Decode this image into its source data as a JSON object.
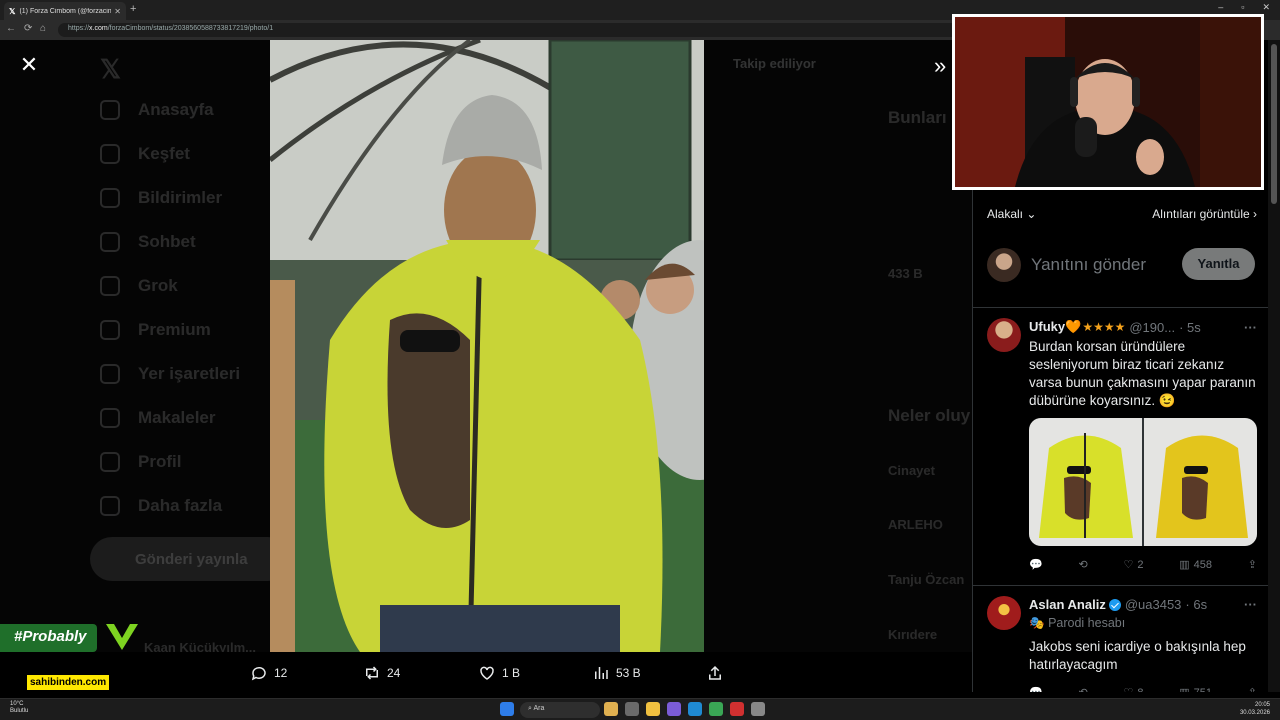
{
  "browser": {
    "tab_title": "(1) Forza Cimbom (@forzacimbom",
    "url_prefix": "https://",
    "url_domain": "x.com",
    "url_path": "/forzaCimbom/status/2038560588733817219/photo/1"
  },
  "background": {
    "nav_items": [
      "Anasayfa",
      "Keşfet",
      "Bildirimler",
      "Sohbet",
      "Grok",
      "Premium",
      "Yer işaretleri",
      "Makaleler",
      "Profil",
      "Daha fazla"
    ],
    "post_button": "Gönderi yayınla",
    "follow_label": "Takip ediliyor",
    "right_heading": "Bunları",
    "trends_heading": "Neler oluy",
    "trend_items": [
      "Cinayet",
      "ARLEHO",
      "Tanju Özcan",
      "Kırıdere"
    ],
    "account_name": "Kaan Küçükyılm...",
    "count_433": "433 B"
  },
  "actions": {
    "replies": "12",
    "reposts": "24",
    "likes": "1 B",
    "views": "53 B"
  },
  "reply_panel": {
    "sort_label": "Alakalı",
    "quotes_link": "Alıntıları görüntüle",
    "compose_placeholder": "Yanıtını gönder",
    "reply_button": "Yanıtla"
  },
  "tweets": [
    {
      "name": "Ufuky🧡",
      "stars": "★★★★",
      "handle": "@190...",
      "time": "· 5s",
      "body": "Burdan korsan üründülere sesleniyorum biraz ticari zekanız varsa bunun çakmasını yapar paranın dübürüne koyarsınız. 😉",
      "replies": "",
      "reposts": "",
      "likes": "2",
      "views": "458"
    },
    {
      "name": "Aslan Analiz",
      "handle": "@ua3453",
      "time": "· 6s",
      "label": "Parodi hesabı",
      "body": "Jakobs seni icardiye o bakışınla hep hatırlayacagım",
      "likes": "8",
      "views": "751"
    }
  ],
  "overlays": {
    "hashtag": "#Probably",
    "sponsor": "sahibinden.com"
  },
  "taskbar": {
    "weather_temp": "10°C",
    "weather_desc": "Bulutlu",
    "search_label": "Ara",
    "time": "20:05",
    "date": "30.03.2026"
  },
  "colors": {
    "accent": "#1d9bf0",
    "star": "#f4a21c",
    "jacket": "#c8d437",
    "probably_bg": "#1f6f2a",
    "sponsor_bg": "#ffe800"
  }
}
